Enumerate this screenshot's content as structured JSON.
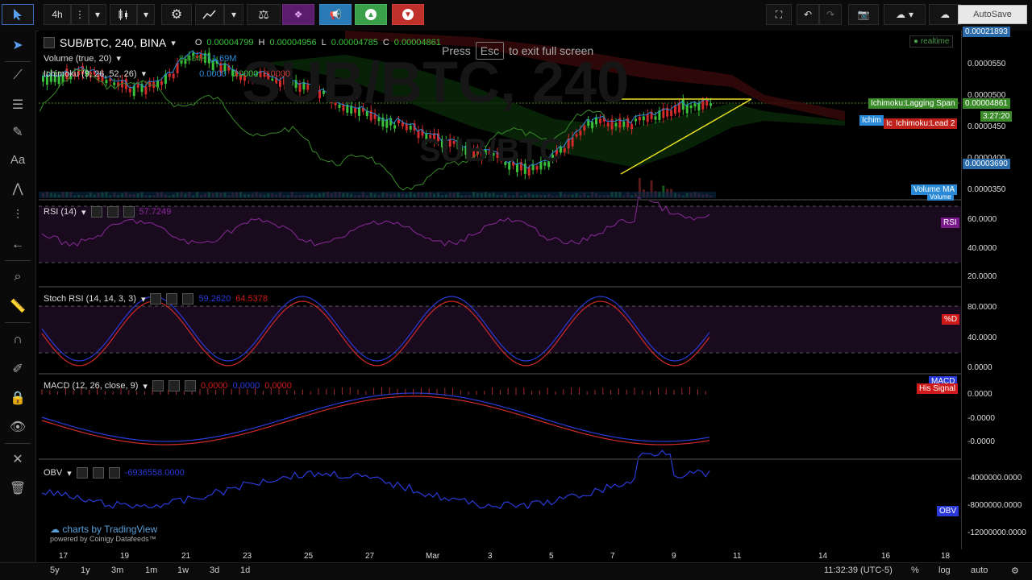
{
  "toolbar": {
    "interval": "4h",
    "autosave": "AutoSave"
  },
  "symbol": {
    "name": "SUB/BTC, 240, BINA",
    "o_label": "O",
    "o_value": "0.00004799",
    "h_label": "H",
    "h_value": "0.00004956",
    "l_label": "L",
    "l_value": "0.00004785",
    "c_label": "C",
    "c_value": "0.00004861",
    "watermark_big": "SUB/BTC, 240",
    "watermark_small": "SUB/BTC"
  },
  "fullscreen_msg": {
    "press": "Press",
    "key": "Esc",
    "rest": "to exit full screen"
  },
  "realtime": "realtime",
  "legends": {
    "volume": "Volume (true, 20)",
    "volume_vals": [
      "8.884K",
      "1.69M"
    ],
    "ichimoku": "Ichimoku (9, 26, 52, 26)",
    "ichimoku_vals": [
      "0.0000",
      "0.0000",
      "0.0000"
    ],
    "rsi": "RSI (14)",
    "rsi_val": "57.7249",
    "stoch": "Stoch RSI (14, 14, 3, 3)",
    "stoch_vals": [
      "59.2620",
      "64.5378"
    ],
    "macd": "MACD (12, 26, close, 9)",
    "macd_vals": [
      "0.0000",
      "0.0000",
      "0.0000"
    ],
    "obv": "OBV",
    "obv_val": "-6936558.0000"
  },
  "yaxis": {
    "main": [
      "0.00021893",
      "0.0000550",
      "0.0000500",
      "0.0000450",
      "0.0000400",
      "0.0000350"
    ],
    "main_badges": {
      "price": "0.00004861",
      "timer": "3:27:20",
      "low": "0.00003690",
      "lagging": "Ichimoku:Lagging Span",
      "lead2": "Ichimoku:Lead 2",
      "ichim_short": "Ichim",
      "ic": "Ic",
      "volume_ma": "Volume MA",
      "volume": "Volume"
    },
    "rsi": [
      "60.0000",
      "40.0000",
      "20.0000"
    ],
    "rsi_badge": "RSI",
    "stoch": [
      "80.0000",
      "40.0000",
      "0.0000"
    ],
    "stoch_badge": "%D",
    "macd": [
      "0.0000",
      "-0.0000",
      "-0.0000"
    ],
    "macd_badge1": "MACD",
    "macd_badge2": "His Signal",
    "obv": [
      "-4000000.0000",
      "-8000000.0000",
      "-12000000.0000"
    ],
    "obv_badge": "OBV"
  },
  "xaxis": [
    "17",
    "19",
    "21",
    "23",
    "25",
    "27",
    "Mar",
    "3",
    "5",
    "7",
    "9",
    "11",
    "14",
    "16",
    "18"
  ],
  "bottom": {
    "ranges": [
      "5y",
      "1y",
      "3m",
      "1m",
      "1w",
      "3d",
      "1d"
    ],
    "time": "11:32:39 (UTC-5)",
    "pct": "%",
    "log": "log",
    "auto": "auto"
  },
  "branding": {
    "line1": "charts by TradingView",
    "line2": "powered by Coinigy Datafeeds™"
  },
  "chart_data": {
    "type": "candlestick",
    "title": "SUB/BTC, 240, BINA",
    "x_ticks": [
      "17",
      "19",
      "21",
      "23",
      "25",
      "27",
      "Mar",
      "3",
      "5",
      "7",
      "9",
      "11",
      "14",
      "16",
      "18"
    ],
    "y_range": [
      3.3e-05,
      5.8e-05
    ],
    "last_close": 4.861e-05,
    "indicators": [
      "Volume (true, 20)",
      "Ichimoku (9, 26, 52, 26)",
      "RSI (14)",
      "Stoch RSI (14, 14, 3, 3)",
      "MACD (12, 26, close, 9)",
      "OBV"
    ],
    "rsi_last": 57.7249,
    "stoch_last": [
      59.262,
      64.5378
    ],
    "obv_last": -6936558
  }
}
